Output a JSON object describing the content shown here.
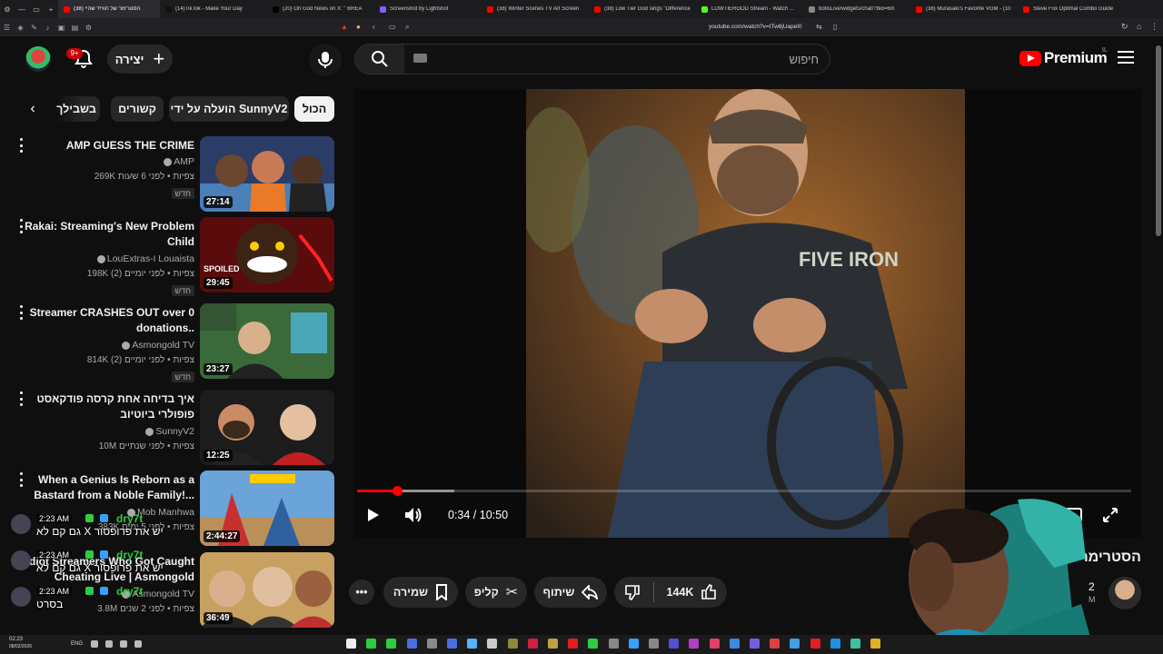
{
  "browser": {
    "tabs": [
      {
        "label": "הסטרימר של הווייד שהיי (38)",
        "color": "#ff0000",
        "active": true
      },
      {
        "label": "(14)TikTok - Make Your Day",
        "color": "#111111"
      },
      {
        "label": "(20) On God News on X: \" BREA",
        "color": "#000000"
      },
      {
        "label": "Screenshot by Lightshot",
        "color": "#8a5cf6"
      },
      {
        "label": "(38) Winter Scenes TV Art Screen",
        "color": "#ff0000"
      },
      {
        "label": "(38) Low Tier God sings \"Difference",
        "color": "#ff0000"
      },
      {
        "label": "LOWTIERGOD Stream - Watch Live",
        "color": "#53fc18"
      },
      {
        "label": "botisLive/widgets/chat/?bid=6m",
        "color": "#888888"
      },
      {
        "label": "(38) Murasaki's Favorite VGM - (10",
        "color": "#ff0000"
      },
      {
        "label": "Steve Fox Optimal Combo Guide",
        "color": "#ff0000"
      }
    ],
    "url": "youtube.com/watch?v=tTw8jUapel0"
  },
  "header": {
    "notification_count": "9+",
    "create_label": "יצירה",
    "search_placeholder": "חיפוש",
    "logo_word": "Premium",
    "country_code": "IL"
  },
  "chips": [
    "הכול",
    "הועלה על ידי SunnyV2",
    "קשורים",
    "בשבילך"
  ],
  "recommendations": [
    {
      "title": "AMP GUESS THE CRIME",
      "channel": "AMP",
      "meta": "269K צפיות • לפני 6 שעות",
      "badge": "חדש",
      "duration": "27:14",
      "thumb": "amp"
    },
    {
      "title": "Rakai: Streaming's New Problem Child",
      "channel": "LouExtras-ו Louaista",
      "meta": "198K צפיות • לפני יומיים (2)",
      "badge": "חדש",
      "duration": "29:45",
      "thumb": "rakai"
    },
    {
      "title": "Streamer CRASHES OUT over 0 donations..",
      "channel": "Asmongold TV",
      "meta": "814K צפיות • לפני יומיים (2)",
      "badge": "חדש",
      "duration": "23:27",
      "thumb": "streamer"
    },
    {
      "title": "איך בדיחה אחת קרסה פודקאסט פופולרי ביוטיוב",
      "channel": "SunnyV2",
      "meta": "10M צפיות • לפני שנתיים",
      "badge": "",
      "duration": "12:25",
      "thumb": "podcast"
    },
    {
      "title": "When a Genius Is Reborn as a Bastard from a Noble Family!...",
      "channel": "Mob Manhwa",
      "meta": "383K צפיות • לפני 5 ימים",
      "badge": "",
      "duration": "2:44:27",
      "thumb": "manhwa"
    },
    {
      "title": "Idiot Streamers Who Got Caught Cheating Live | Asmongold",
      "channel": "Asmongold TV",
      "meta": "3.8M צפיות • לפני 2 שנים",
      "badge": "",
      "duration": "36:49",
      "thumb": "idiot"
    }
  ],
  "player": {
    "time": "0:34 / 10:50",
    "progress": 0.052,
    "buffered": 0.125
  },
  "video": {
    "title": "הסטרימר ... נתו",
    "likes": "144K",
    "share_label": "שיתוף",
    "clip_label": "קליפ",
    "save_label": "שמירה",
    "subs_num": "2",
    "subs_unit": "M"
  },
  "chat": [
    {
      "time": "2:23 AM",
      "user": "dry7t",
      "msg": "גם קם לא X יש את פרופסור"
    },
    {
      "time": "2:23 AM",
      "user": "dry7t",
      "msg": "גם קם לא X יש את פרופסור"
    },
    {
      "time": "2:23 AM",
      "user": "dry7t",
      "msg": "בסרט"
    }
  ],
  "taskbar": {
    "time": "02:23",
    "date": "08/02/2026",
    "lang": "ENG"
  },
  "colors": {
    "accent": "#ff0000",
    "background": "#0f0f0f",
    "chip": "#272727",
    "chat_user": "#2ecc40"
  }
}
